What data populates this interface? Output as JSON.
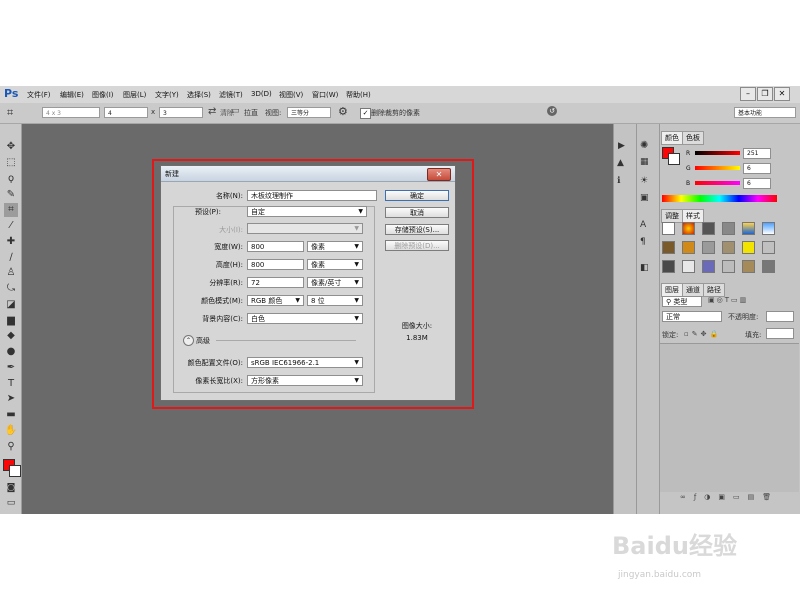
{
  "app": {
    "logo": "Ps"
  },
  "menu": [
    "文件(F)",
    "编辑(E)",
    "图像(I)",
    "图层(L)",
    "文字(Y)",
    "选择(S)",
    "滤镜(T)",
    "3D(D)",
    "视图(V)",
    "窗口(W)",
    "帮助(H)"
  ],
  "window_controls": {
    "minimize": "–",
    "restore": "❐",
    "close": "✕"
  },
  "options_bar": {
    "ratio": "4 x 3",
    "width": "4",
    "times": "x",
    "height": "3",
    "clear": "清除",
    "straighten": "拉直",
    "view_label": "视图:",
    "view_value": "三等分",
    "delete_cropped": "删除裁剪的像素",
    "workspace": "基本功能"
  },
  "dialog": {
    "title": "新建",
    "name_label": "名称(N):",
    "name_value": "木板纹理制作",
    "preset_label": "预设(P):",
    "preset_value": "自定",
    "size_label": "大小(I):",
    "width_label": "宽度(W):",
    "width_value": "800",
    "width_unit": "像素",
    "height_label": "高度(H):",
    "height_value": "800",
    "height_unit": "像素",
    "resolution_label": "分辨率(R):",
    "resolution_value": "72",
    "resolution_unit": "像素/英寸",
    "mode_label": "颜色模式(M):",
    "mode_value": "RGB 颜色",
    "bits_value": "8 位",
    "bg_label": "背景内容(C):",
    "bg_value": "白色",
    "advanced": "高级",
    "profile_label": "颜色配置文件(O):",
    "profile_value": "sRGB IEC61966-2.1",
    "aspect_label": "像素长宽比(X):",
    "aspect_value": "方形像素",
    "ok": "确定",
    "cancel": "取消",
    "save_preset": "存储预设(S)...",
    "delete_preset": "删除预设(D)...",
    "image_size_label": "图像大小:",
    "image_size_value": "1.83M"
  },
  "panels": {
    "color_tabs": [
      "颜色",
      "色板"
    ],
    "r_value": "251",
    "g_value": "6",
    "b_value": "6",
    "adjust_tabs": [
      "调整",
      "样式"
    ],
    "layer_tabs": [
      "图层",
      "通道",
      "路径"
    ],
    "kind": "类型",
    "blend": "正常",
    "opacity_label": "不透明度:",
    "lock_label": "锁定:",
    "fill_label": "填充:"
  },
  "colors": {
    "foreground": "#fb0606",
    "background": "#ffffff",
    "highlight": "#e11818"
  },
  "watermark": {
    "brand": "Baidu经验",
    "url": "jingyan.baidu.com"
  }
}
